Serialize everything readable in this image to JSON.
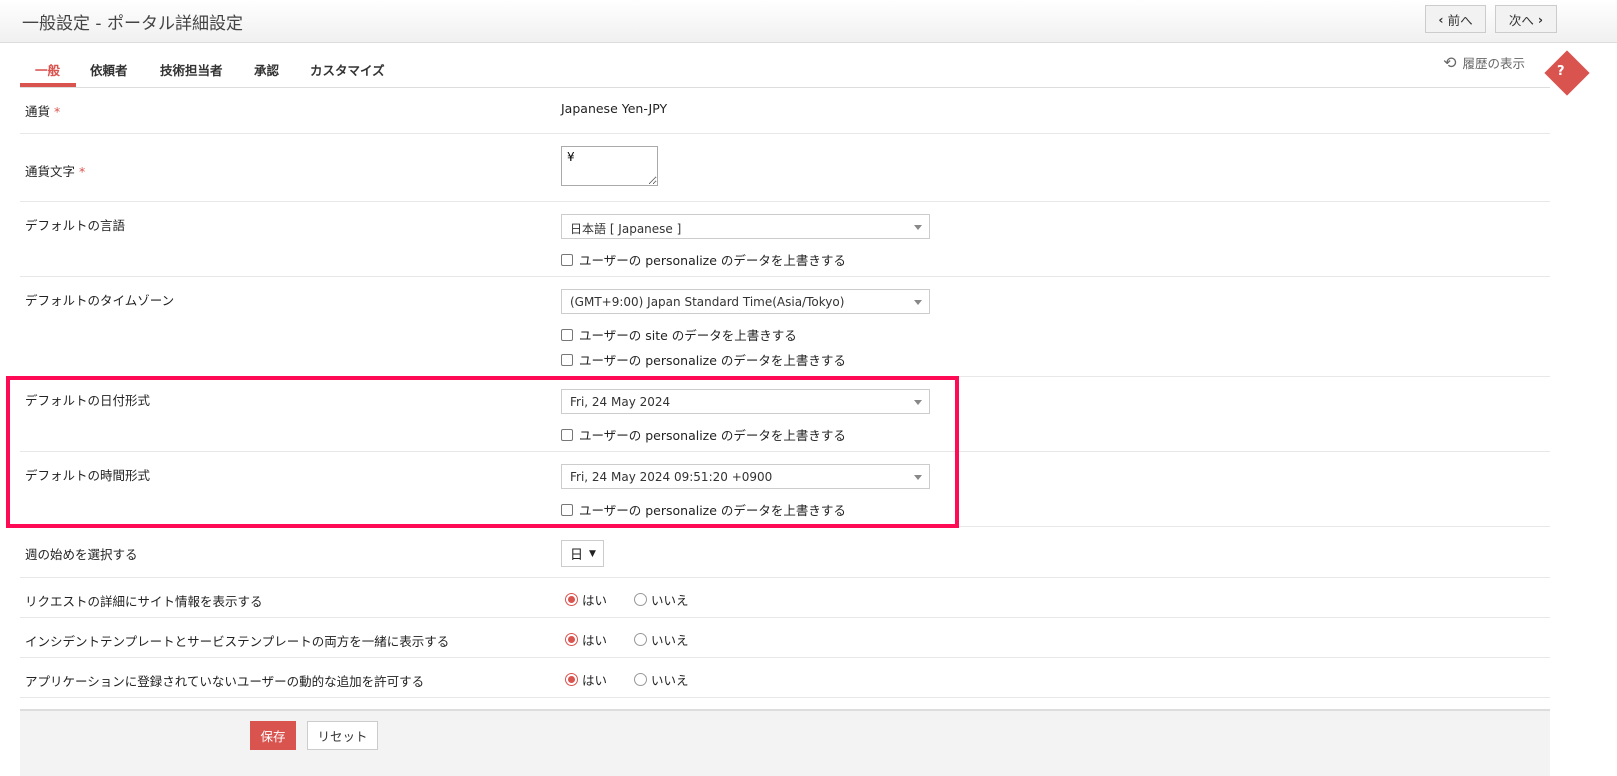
{
  "header": {
    "title": "一般設定 - ポータル詳細設定",
    "prev": "前へ",
    "next": "次へ"
  },
  "tabs": [
    "一般",
    "依頼者",
    "技術担当者",
    "承認",
    "カスタマイズ"
  ],
  "history": "履歴の表示",
  "help": "?",
  "rows": {
    "currency": {
      "label": "通貨",
      "value": "Japanese Yen-JPY"
    },
    "symbol": {
      "label": "通貨文字",
      "value": "¥"
    },
    "language": {
      "label": "デフォルトの言語",
      "value": "日本語 [ Japanese ]",
      "chk": "ユーザーの personalize のデータを上書きする"
    },
    "timezone": {
      "label": "デフォルトのタイムゾーン",
      "value": "(GMT+9:00) Japan Standard Time(Asia/Tokyo)",
      "chk1": "ユーザーの site のデータを上書きする",
      "chk2": "ユーザーの personalize のデータを上書きする"
    },
    "dateformat": {
      "label": "デフォルトの日付形式",
      "value": "Fri, 24 May 2024",
      "chk": "ユーザーの personalize のデータを上書きする"
    },
    "timeformat": {
      "label": "デフォルトの時間形式",
      "value": "Fri, 24 May 2024 09:51:20 +0900",
      "chk": "ユーザーの personalize のデータを上書きする"
    },
    "week": {
      "label": "週の始めを選択する",
      "value": "日"
    },
    "site": {
      "label": "リクエストの詳細にサイト情報を表示する"
    },
    "templates": {
      "label": "インシデントテンプレートとサービステンプレートの両方を一緒に表示する"
    },
    "dynamic": {
      "label": "アプリケーションに登録されていないユーザーの動的な追加を許可する"
    }
  },
  "yes": "はい",
  "no": "いいえ",
  "required": "*",
  "footer": {
    "save": "保存",
    "reset": "リセット"
  },
  "colors": {
    "accent": "#d9534f",
    "highlight": "#ff0a55"
  }
}
